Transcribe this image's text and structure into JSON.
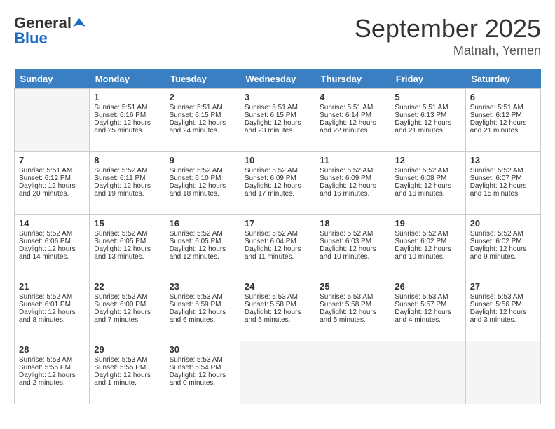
{
  "header": {
    "logo_general": "General",
    "logo_blue": "Blue",
    "month": "September 2025",
    "location": "Matnah, Yemen"
  },
  "days_of_week": [
    "Sunday",
    "Monday",
    "Tuesday",
    "Wednesday",
    "Thursday",
    "Friday",
    "Saturday"
  ],
  "weeks": [
    [
      {
        "day": "",
        "empty": true
      },
      {
        "day": "1",
        "sunrise": "5:51 AM",
        "sunset": "6:16 PM",
        "daylight": "12 hours and 25 minutes."
      },
      {
        "day": "2",
        "sunrise": "5:51 AM",
        "sunset": "6:15 PM",
        "daylight": "12 hours and 24 minutes."
      },
      {
        "day": "3",
        "sunrise": "5:51 AM",
        "sunset": "6:15 PM",
        "daylight": "12 hours and 23 minutes."
      },
      {
        "day": "4",
        "sunrise": "5:51 AM",
        "sunset": "6:14 PM",
        "daylight": "12 hours and 22 minutes."
      },
      {
        "day": "5",
        "sunrise": "5:51 AM",
        "sunset": "6:13 PM",
        "daylight": "12 hours and 21 minutes."
      },
      {
        "day": "6",
        "sunrise": "5:51 AM",
        "sunset": "6:12 PM",
        "daylight": "12 hours and 21 minutes."
      }
    ],
    [
      {
        "day": "7",
        "sunrise": "5:51 AM",
        "sunset": "6:12 PM",
        "daylight": "12 hours and 20 minutes."
      },
      {
        "day": "8",
        "sunrise": "5:52 AM",
        "sunset": "6:11 PM",
        "daylight": "12 hours and 19 minutes."
      },
      {
        "day": "9",
        "sunrise": "5:52 AM",
        "sunset": "6:10 PM",
        "daylight": "12 hours and 18 minutes."
      },
      {
        "day": "10",
        "sunrise": "5:52 AM",
        "sunset": "6:09 PM",
        "daylight": "12 hours and 17 minutes."
      },
      {
        "day": "11",
        "sunrise": "5:52 AM",
        "sunset": "6:09 PM",
        "daylight": "12 hours and 16 minutes."
      },
      {
        "day": "12",
        "sunrise": "5:52 AM",
        "sunset": "6:08 PM",
        "daylight": "12 hours and 16 minutes."
      },
      {
        "day": "13",
        "sunrise": "5:52 AM",
        "sunset": "6:07 PM",
        "daylight": "12 hours and 15 minutes."
      }
    ],
    [
      {
        "day": "14",
        "sunrise": "5:52 AM",
        "sunset": "6:06 PM",
        "daylight": "12 hours and 14 minutes."
      },
      {
        "day": "15",
        "sunrise": "5:52 AM",
        "sunset": "6:05 PM",
        "daylight": "12 hours and 13 minutes."
      },
      {
        "day": "16",
        "sunrise": "5:52 AM",
        "sunset": "6:05 PM",
        "daylight": "12 hours and 12 minutes."
      },
      {
        "day": "17",
        "sunrise": "5:52 AM",
        "sunset": "6:04 PM",
        "daylight": "12 hours and 11 minutes."
      },
      {
        "day": "18",
        "sunrise": "5:52 AM",
        "sunset": "6:03 PM",
        "daylight": "12 hours and 10 minutes."
      },
      {
        "day": "19",
        "sunrise": "5:52 AM",
        "sunset": "6:02 PM",
        "daylight": "12 hours and 10 minutes."
      },
      {
        "day": "20",
        "sunrise": "5:52 AM",
        "sunset": "6:02 PM",
        "daylight": "12 hours and 9 minutes."
      }
    ],
    [
      {
        "day": "21",
        "sunrise": "5:52 AM",
        "sunset": "6:01 PM",
        "daylight": "12 hours and 8 minutes."
      },
      {
        "day": "22",
        "sunrise": "5:52 AM",
        "sunset": "6:00 PM",
        "daylight": "12 hours and 7 minutes."
      },
      {
        "day": "23",
        "sunrise": "5:53 AM",
        "sunset": "5:59 PM",
        "daylight": "12 hours and 6 minutes."
      },
      {
        "day": "24",
        "sunrise": "5:53 AM",
        "sunset": "5:58 PM",
        "daylight": "12 hours and 5 minutes."
      },
      {
        "day": "25",
        "sunrise": "5:53 AM",
        "sunset": "5:58 PM",
        "daylight": "12 hours and 5 minutes."
      },
      {
        "day": "26",
        "sunrise": "5:53 AM",
        "sunset": "5:57 PM",
        "daylight": "12 hours and 4 minutes."
      },
      {
        "day": "27",
        "sunrise": "5:53 AM",
        "sunset": "5:56 PM",
        "daylight": "12 hours and 3 minutes."
      }
    ],
    [
      {
        "day": "28",
        "sunrise": "5:53 AM",
        "sunset": "5:55 PM",
        "daylight": "12 hours and 2 minutes."
      },
      {
        "day": "29",
        "sunrise": "5:53 AM",
        "sunset": "5:55 PM",
        "daylight": "12 hours and 1 minute."
      },
      {
        "day": "30",
        "sunrise": "5:53 AM",
        "sunset": "5:54 PM",
        "daylight": "12 hours and 0 minutes."
      },
      {
        "day": "",
        "empty": true
      },
      {
        "day": "",
        "empty": true
      },
      {
        "day": "",
        "empty": true
      },
      {
        "day": "",
        "empty": true
      }
    ]
  ]
}
